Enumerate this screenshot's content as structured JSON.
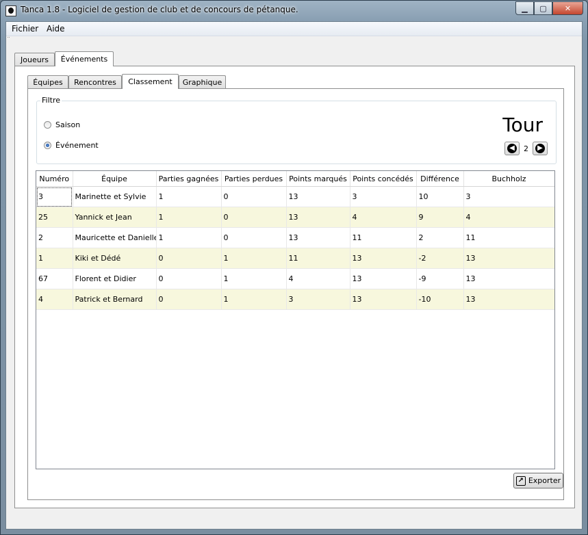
{
  "window": {
    "title": "Tanca 1.8 - Logiciel de gestion de club et de concours de pétanque."
  },
  "menu": {
    "items": [
      "Fichier",
      "Aide"
    ]
  },
  "outer_tabs": [
    {
      "label": "Joueurs",
      "active": false
    },
    {
      "label": "Événements",
      "active": true
    }
  ],
  "inner_tabs": [
    {
      "label": "Équipes",
      "active": false
    },
    {
      "label": "Rencontres",
      "active": false
    },
    {
      "label": "Classement",
      "active": true
    },
    {
      "label": "Graphique",
      "active": false
    }
  ],
  "filter": {
    "title": "Filtre",
    "options": [
      {
        "label": "Saison",
        "checked": false
      },
      {
        "label": "Événement",
        "checked": true
      }
    ]
  },
  "round": {
    "title": "Tour",
    "value": "2",
    "prev_icon": "arrow-left-icon",
    "next_icon": "arrow-right-icon"
  },
  "table": {
    "headers": [
      "Numéro",
      "Équipe",
      "Parties gagnées",
      "Parties perdues",
      "Points marqués",
      "Points concédés",
      "Différence",
      "Buchholz"
    ],
    "rows": [
      [
        "3",
        "Marinette et Sylvie",
        "1",
        "0",
        "13",
        "3",
        "10",
        "3"
      ],
      [
        "25",
        "Yannick et Jean",
        "1",
        "0",
        "13",
        "4",
        "9",
        "4"
      ],
      [
        "2",
        "Mauricette et Danielle",
        "1",
        "0",
        "13",
        "11",
        "2",
        "11"
      ],
      [
        "1",
        "Kiki et Dédé",
        "0",
        "1",
        "11",
        "13",
        "-2",
        "13"
      ],
      [
        "67",
        "Florent et Didier",
        "0",
        "1",
        "4",
        "13",
        "-9",
        "13"
      ],
      [
        "4",
        "Patrick et Bernard",
        "0",
        "1",
        "3",
        "13",
        "-10",
        "13"
      ]
    ]
  },
  "export": {
    "label": "Exporter",
    "icon": "export-icon"
  },
  "colors": {
    "alt_row": "#f7f7dd",
    "window_frame": "#8aa0b3"
  }
}
